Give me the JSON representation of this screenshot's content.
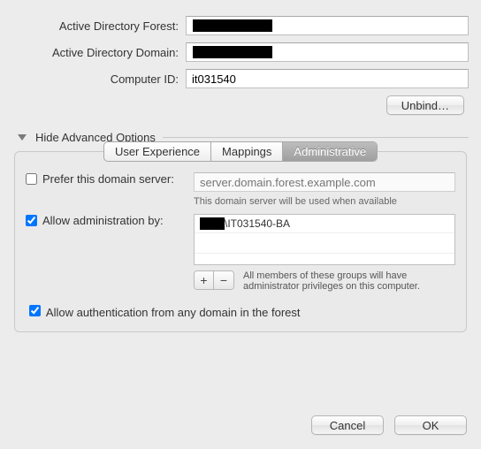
{
  "labels": {
    "adForest": "Active Directory Forest:",
    "adDomain": "Active Directory Domain:",
    "computerId": "Computer ID:"
  },
  "values": {
    "adForest": "",
    "adDomain": "",
    "computerId": "it031540"
  },
  "buttons": {
    "unbind": "Unbind…",
    "cancel": "Cancel",
    "ok": "OK"
  },
  "disclosure": {
    "label": "Hide Advanced Options"
  },
  "tabs": {
    "userExperience": "User Experience",
    "mappings": "Mappings",
    "administrative": "Administrative"
  },
  "admin": {
    "preferServer": {
      "label": "Prefer this domain server:",
      "placeholder": "server.domain.forest.example.com",
      "hint": "This domain server will be used when available",
      "checked": false
    },
    "allowAdmin": {
      "label": "Allow administration by:",
      "checked": true,
      "entries": [
        "\\IT031540-BA"
      ],
      "plus": "+",
      "minus": "−",
      "note": "All members of these groups will have administrator privileges on this computer."
    },
    "allowAuth": {
      "label": "Allow authentication from any domain in the forest",
      "checked": true
    }
  }
}
